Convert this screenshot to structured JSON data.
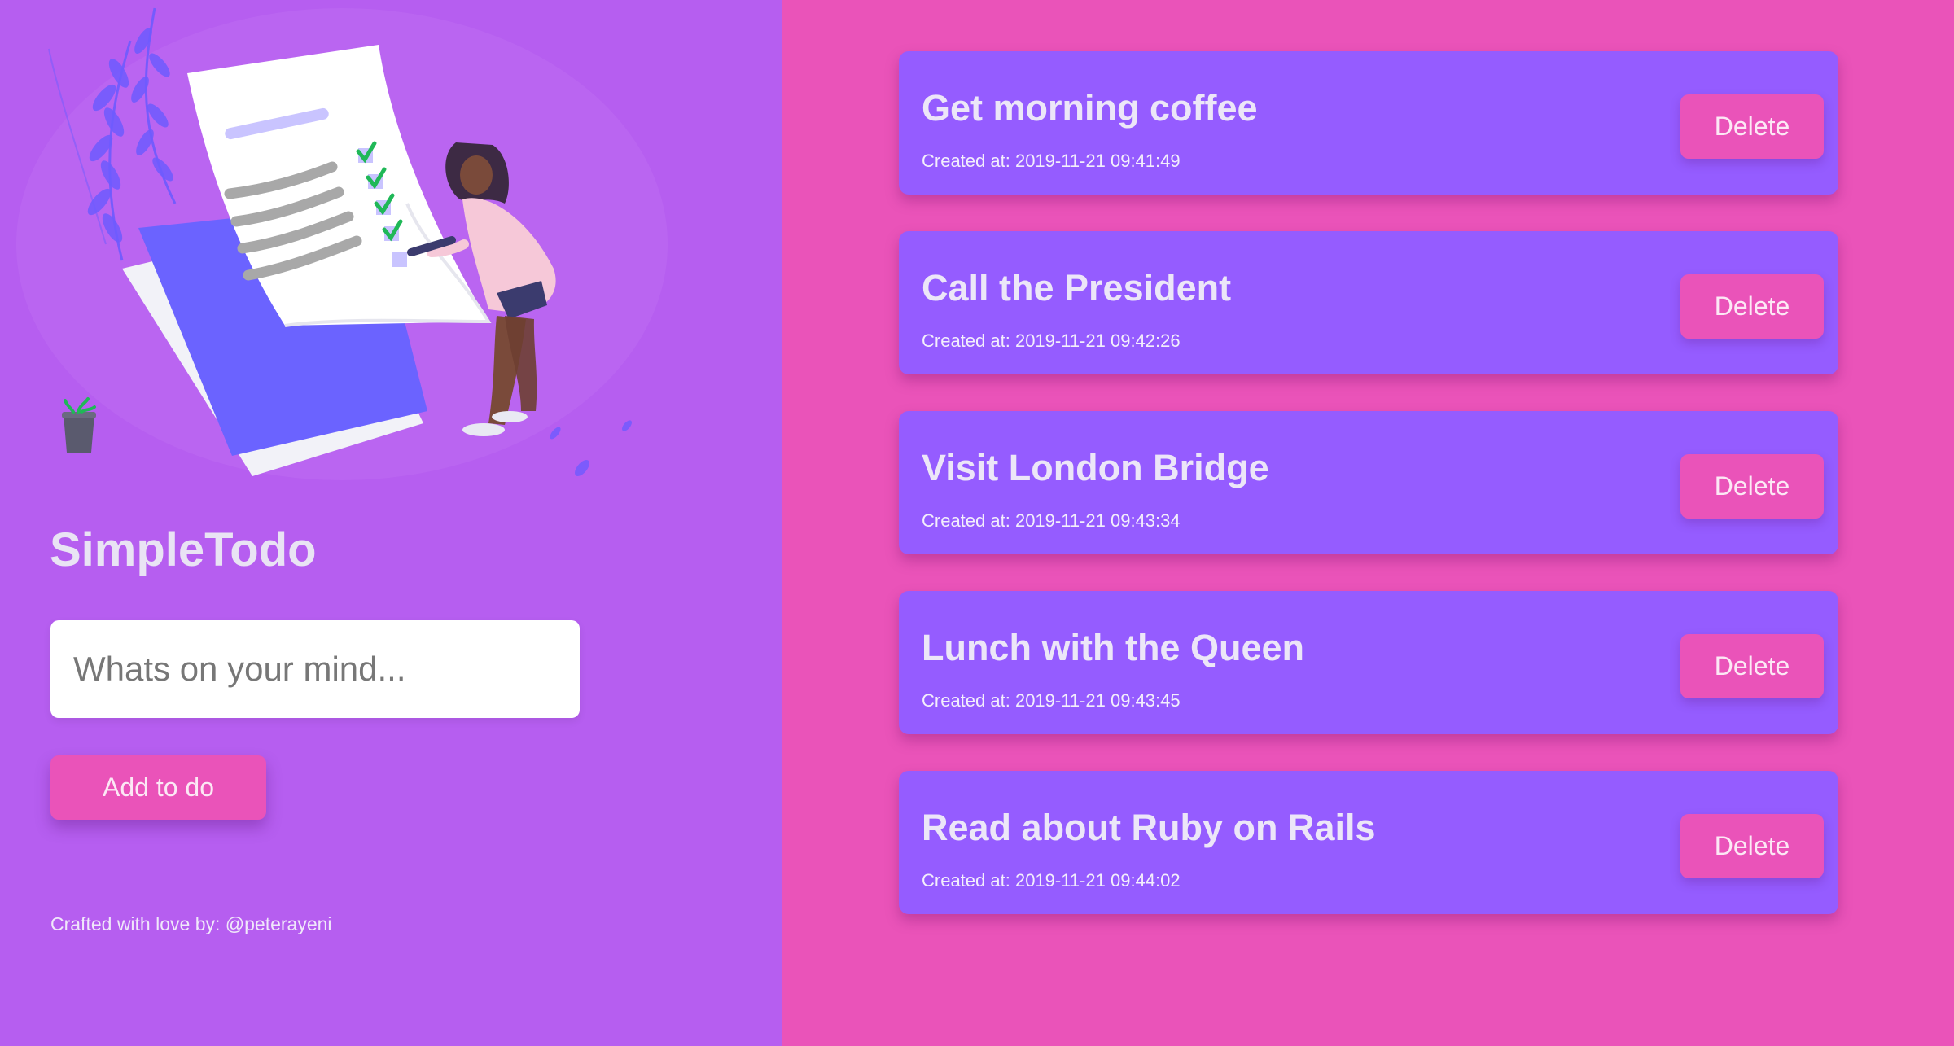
{
  "app": {
    "title": "SimpleTodo"
  },
  "form": {
    "input_placeholder": "Whats on your mind...",
    "input_value": "",
    "add_label": "Add to do"
  },
  "footer": {
    "credit": "Crafted with love by: @peterayeni"
  },
  "todos": [
    {
      "title": "Get morning coffee",
      "created": "Created at: 2019-11-21 09:41:49",
      "delete_label": "Delete"
    },
    {
      "title": "Call the President",
      "created": "Created at: 2019-11-21 09:42:26",
      "delete_label": "Delete"
    },
    {
      "title": "Visit London Bridge",
      "created": "Created at: 2019-11-21 09:43:34",
      "delete_label": "Delete"
    },
    {
      "title": "Lunch with the Queen",
      "created": "Created at: 2019-11-21 09:43:45",
      "delete_label": "Delete"
    },
    {
      "title": "Read about Ruby on Rails",
      "created": "Created at: 2019-11-21 09:44:02",
      "delete_label": "Delete"
    }
  ],
  "colors": {
    "left_background": "#b65ef0",
    "right_background": "#ea53b9",
    "card_background": "#955cff",
    "button_accent": "#ea53b9"
  },
  "illustration": {
    "icon": "checklist-illustration",
    "plant_icon": "potted-plant-icon",
    "person_icon": "person-checking-list-icon"
  }
}
